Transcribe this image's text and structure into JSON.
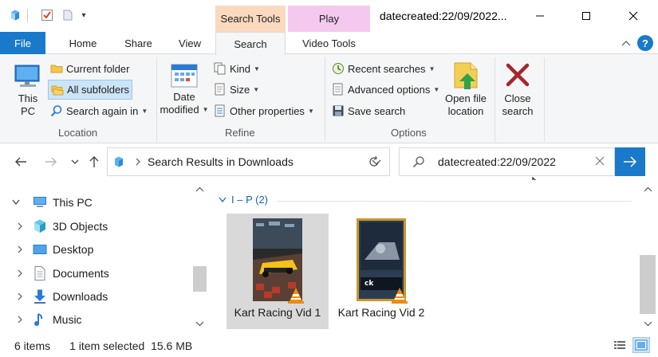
{
  "window": {
    "title": "datecreated:22/09/2022...",
    "context_tabs": {
      "search_tools": "Search Tools",
      "play": "Play"
    }
  },
  "ribbon_tabs": [
    "File",
    "Home",
    "Share",
    "View",
    "Search",
    "Video Tools"
  ],
  "ribbon": {
    "location": {
      "this_pc": [
        "This",
        "PC"
      ],
      "current_folder": "Current folder",
      "all_subfolders": "All subfolders",
      "search_again_in": "Search again in",
      "group_label": "Location"
    },
    "refine": {
      "date_modified": [
        "Date",
        "modified"
      ],
      "kind": "Kind",
      "size": "Size",
      "other_properties": "Other properties",
      "group_label": "Refine"
    },
    "options": {
      "recent_searches": "Recent searches",
      "advanced_options": "Advanced options",
      "save_search": "Save search",
      "open_file_location": [
        "Open file",
        "location"
      ],
      "group_label": "Options"
    },
    "close": {
      "close_search": [
        "Close",
        "search"
      ]
    }
  },
  "address": {
    "path": "Search Results in Downloads",
    "search_value": "datecreated:22/09/2022"
  },
  "nav_pane": {
    "items": [
      {
        "label": "This PC",
        "icon": "pc-icon",
        "expanded": true
      },
      {
        "label": "3D Objects",
        "icon": "cube-icon"
      },
      {
        "label": "Desktop",
        "icon": "desktop-icon"
      },
      {
        "label": "Documents",
        "icon": "document-icon"
      },
      {
        "label": "Downloads",
        "icon": "download-icon"
      },
      {
        "label": "Music",
        "icon": "music-icon"
      }
    ]
  },
  "content": {
    "group_header": "I – P (2)",
    "files": [
      {
        "name": "Kart Racing Vid 1",
        "selected": true
      },
      {
        "name": "Kart Racing Vid 2",
        "selected": false
      }
    ]
  },
  "status": {
    "item_count": "6 items",
    "selection": "1 item selected  15.6 MB"
  },
  "colors": {
    "accent": "#1979ca",
    "search_tools_tab": "#fbd9bf",
    "play_tab": "#f5c9ef",
    "selection": "#cce4f7",
    "selected_tile": "#d9d9d9",
    "close_x": "#a4262c"
  }
}
